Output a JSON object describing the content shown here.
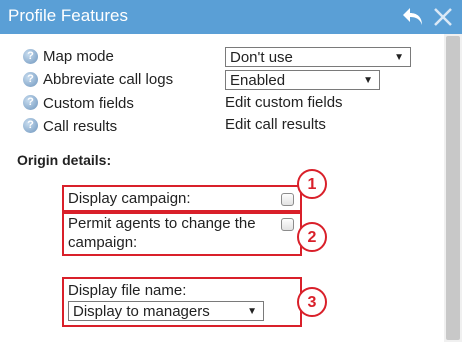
{
  "window": {
    "title": "Profile Features"
  },
  "settings": [
    {
      "label": "Map mode",
      "type": "select",
      "value": "Don't use"
    },
    {
      "label": "Abbreviate call logs",
      "type": "select",
      "value": "Enabled"
    },
    {
      "label": "Custom fields",
      "type": "link",
      "value": "Edit custom fields"
    },
    {
      "label": "Call results",
      "type": "link",
      "value": "Edit call results"
    }
  ],
  "origin": {
    "heading": "Origin details:",
    "display_campaign": {
      "label": "Display campaign:",
      "checked": false,
      "badge": "1"
    },
    "permit_agents": {
      "label_line1": "Permit agents to change the",
      "label_line2": "campaign:",
      "checked": false,
      "badge": "2"
    },
    "display_file_name": {
      "label": "Display file name:",
      "value": "Display to managers",
      "badge": "3"
    }
  },
  "icons": {
    "help": "?",
    "dropdown": "▼"
  },
  "colors": {
    "titlebar": "#5a9fd6",
    "highlight": "#d9202a"
  }
}
